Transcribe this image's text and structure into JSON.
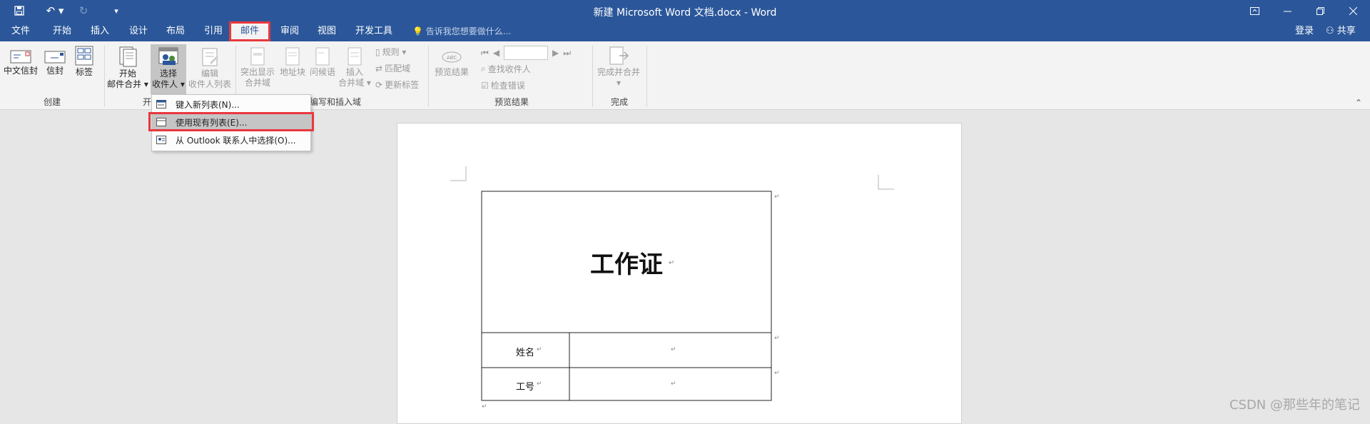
{
  "titlebar": {
    "title": "新建 Microsoft Word 文档.docx - Word"
  },
  "tabs": [
    {
      "label": "文件"
    },
    {
      "label": "开始"
    },
    {
      "label": "插入"
    },
    {
      "label": "设计"
    },
    {
      "label": "布局"
    },
    {
      "label": "引用"
    },
    {
      "label": "邮件"
    },
    {
      "label": "审阅"
    },
    {
      "label": "视图"
    },
    {
      "label": "开发工具"
    }
  ],
  "tellme": {
    "placeholder": "告诉我您想要做什么..."
  },
  "account": {
    "login": "登录",
    "share": "共享"
  },
  "ribbon": {
    "create": {
      "envelope": "中文信封",
      "envelope2": "信封",
      "labels": "标签",
      "group": "创建"
    },
    "start": {
      "start_merge_1": "开始",
      "start_merge_2": "邮件合并 ▾",
      "select_1": "选择",
      "select_2": "收件人 ▾",
      "edit_1": "编辑",
      "edit_2": "收件人列表",
      "group": "开"
    },
    "fields": {
      "highlight_1": "突出显示",
      "highlight_2": "合并域",
      "address": "地址块",
      "greeting": "问候语",
      "insert_1": "插入",
      "insert_2": "合并域 ▾",
      "rules": "规则 ▾",
      "match": "匹配域",
      "update": "更新标签",
      "group": "编写和插入域"
    },
    "preview": {
      "preview": "预览结果",
      "find": "查找收件人",
      "check": "检查错误",
      "group": "预览结果"
    },
    "finish": {
      "finish": "完成并合并",
      "arrow": "▾",
      "group": "完成"
    }
  },
  "menu": {
    "items": [
      {
        "label": "键入新列表(N)..."
      },
      {
        "label": "使用现有列表(E)..."
      },
      {
        "label": "从 Outlook 联系人中选择(O)..."
      }
    ]
  },
  "document": {
    "title": "工作证",
    "name_label": "姓名",
    "id_label": "工号",
    "mark": "↵"
  },
  "watermark": "CSDN @那些年的笔记"
}
